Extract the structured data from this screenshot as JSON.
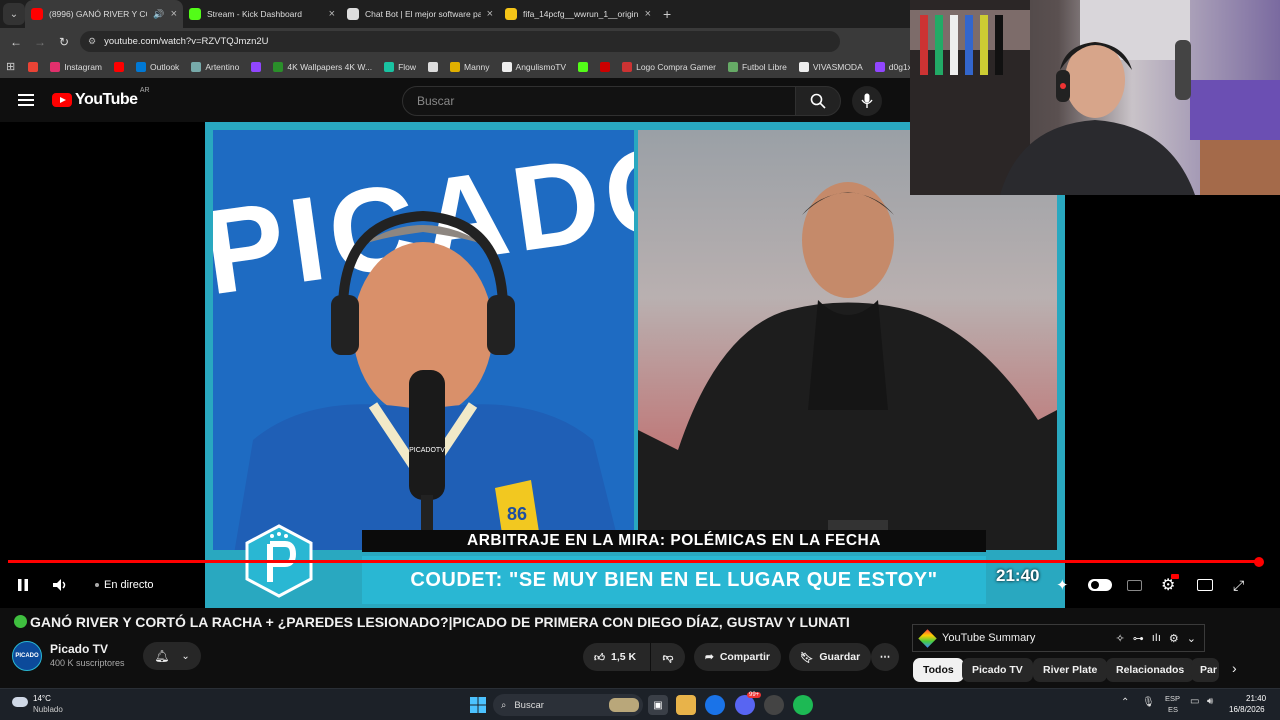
{
  "browser": {
    "tabs": [
      {
        "title": "(8996) GANÓ RIVER Y CO",
        "color": "#ff0000"
      },
      {
        "title": "Stream - Kick Dashboard",
        "color": "#53fc18"
      },
      {
        "title": "Chat Bot | El mejor software pa",
        "color": "#dddddd"
      },
      {
        "title": "fifa_14pcfg__wwrun_1__origin...",
        "color": "#f5c518"
      }
    ],
    "url": "youtube.com/watch?v=RZVTQJmzn2U",
    "bookmarks": [
      {
        "label": "",
        "color": "#ea4335"
      },
      {
        "label": "Instagram",
        "color": "#e1306c"
      },
      {
        "label": "",
        "color": "#ff0000"
      },
      {
        "label": "Outlook",
        "color": "#0078d4"
      },
      {
        "label": "Artentino",
        "color": "#7aa"
      },
      {
        "label": "",
        "color": "#9146ff"
      },
      {
        "label": "4K Wallpapers 4K W...",
        "color": "#2a8f2a"
      },
      {
        "label": "Flow",
        "color": "#19c3a2"
      },
      {
        "label": "",
        "color": "#ddd"
      },
      {
        "label": "Manny",
        "color": "#e0b000"
      },
      {
        "label": "AngulismoTV",
        "color": "#eee"
      },
      {
        "label": "",
        "color": "#53fc18"
      },
      {
        "label": "",
        "color": "#c00"
      },
      {
        "label": "Logo Compra Gamer",
        "color": "#c33"
      },
      {
        "label": "Futbol Libre",
        "color": "#6a6"
      },
      {
        "label": "VIVASMODA",
        "color": "#eee"
      },
      {
        "label": "d0g1xx",
        "color": "#9146ff"
      }
    ]
  },
  "youtube": {
    "country": "AR",
    "logo_text": "YouTube",
    "search_placeholder": "Buscar"
  },
  "video": {
    "headline_top": "ARBITRAJE EN LA MIRA: POLÉMICAS EN LA FECHA",
    "headline_main": "COUDET: \"SE MUY BIEN EN EL LUGAR QUE ESTOY\"",
    "overlay_clock": "21:40",
    "badge_left": "86",
    "mic_label": "PICADOTV",
    "live_label": "En directo",
    "progress": 1.0,
    "title": "GANÓ RIVER Y CORTÓ LA RACHA + ¿PAREDES LESIONADO?|PICADO DE PRIMERA CON DIEGO DÍAZ, GUSTAV Y LUNATI",
    "channel": "Picado TV",
    "channel_avatar_text": "PICADO",
    "subscribers": "400 K suscriptores",
    "likes": "1,5 K",
    "share_label": "Compartir",
    "save_label": "Guardar"
  },
  "sidebar": {
    "summary_label": "YouTube Summary",
    "chips": [
      "Todos",
      "Picado TV",
      "River Plate",
      "Relacionados",
      "Par"
    ]
  },
  "taskbar": {
    "temp": "14°C",
    "weather": "Nublado",
    "search_placeholder": "Buscar",
    "lang_top": "ESP",
    "lang_bottom": "ES",
    "time": "21:40",
    "date": "16/8/2026",
    "discord_badge": "99+"
  }
}
